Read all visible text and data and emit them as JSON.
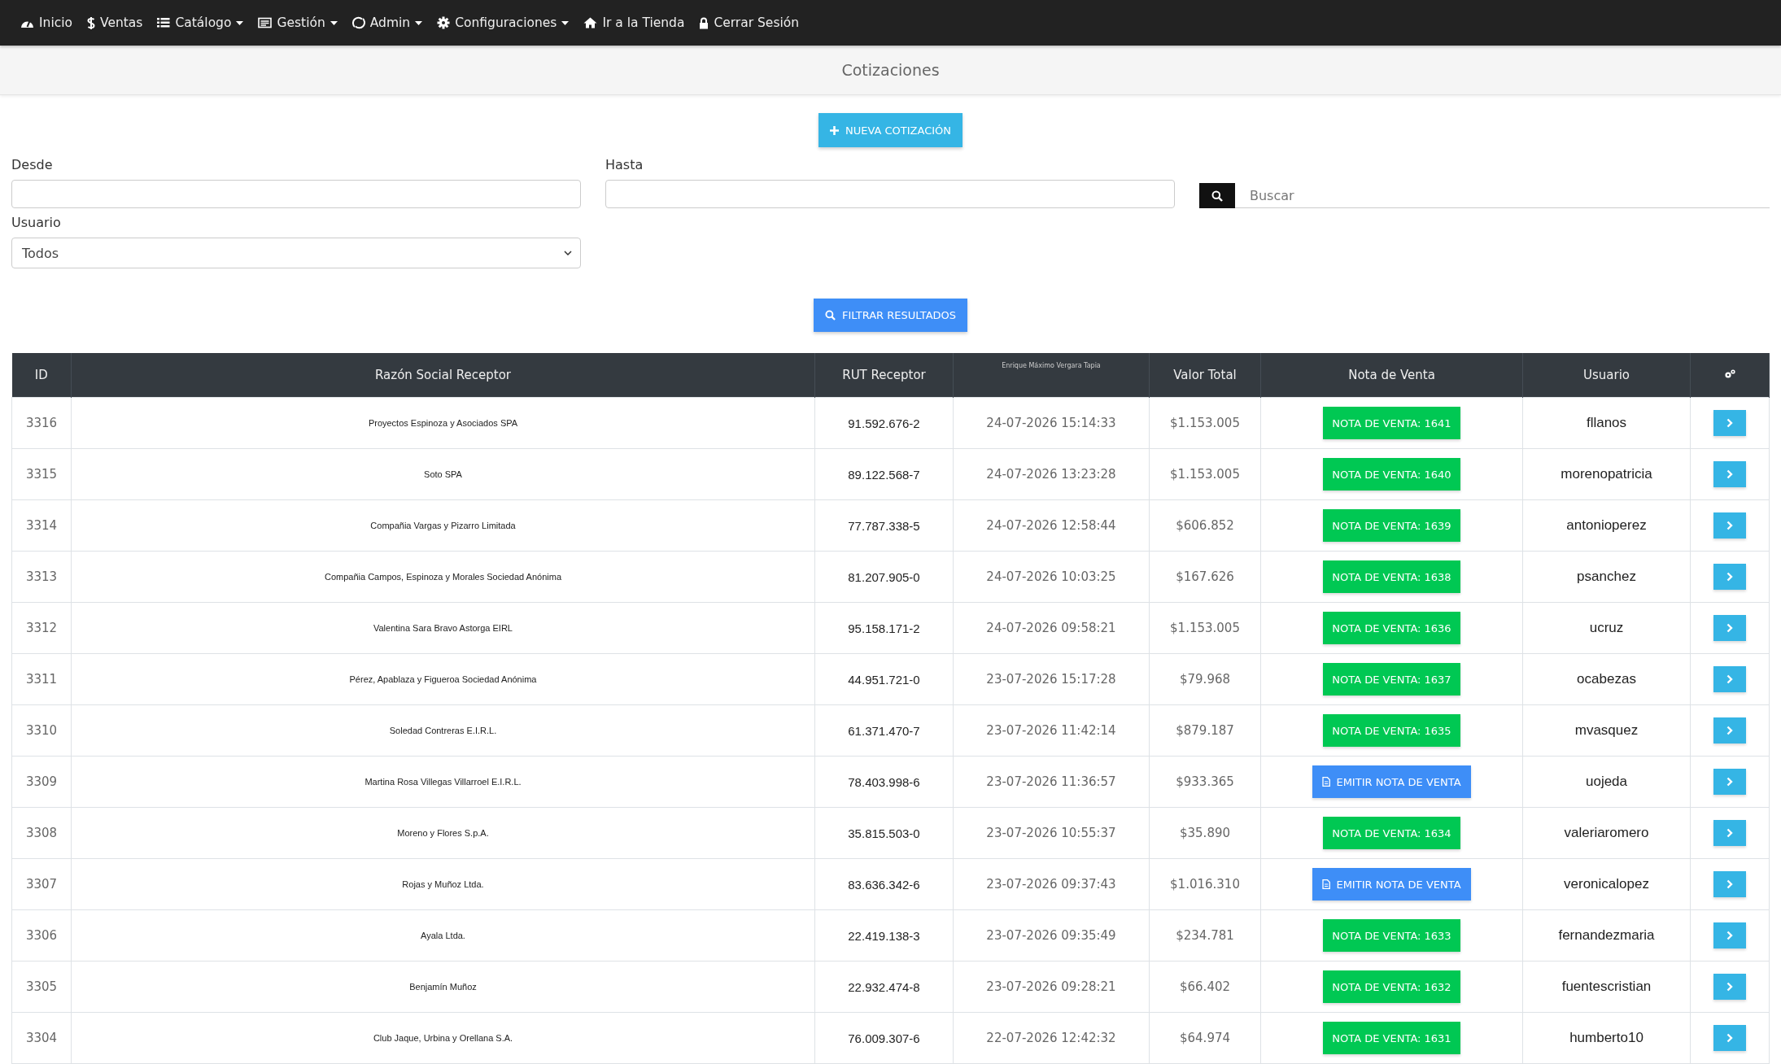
{
  "navbar": {
    "items": [
      {
        "label": "Inicio",
        "dropdown": false
      },
      {
        "label": "Ventas",
        "dropdown": false
      },
      {
        "label": "Catálogo",
        "dropdown": true
      },
      {
        "label": "Gestión",
        "dropdown": true
      },
      {
        "label": "Admin",
        "dropdown": true
      },
      {
        "label": "Configuraciones",
        "dropdown": true
      },
      {
        "label": "Ir a la Tienda",
        "dropdown": false
      },
      {
        "label": "Cerrar Sesión",
        "dropdown": false
      }
    ]
  },
  "page_title": "Cotizaciones",
  "new_button": "NUEVA COTIZACIÓN",
  "filters": {
    "desde": {
      "label": "Desde"
    },
    "hasta": {
      "label": "Hasta"
    },
    "search": {
      "placeholder": "Buscar"
    },
    "usuario": {
      "label": "Usuario",
      "value": "Todos"
    }
  },
  "filter_button": "FILTRAR RESULTADOS",
  "table": {
    "columns": [
      "ID",
      "Razón Social Receptor",
      "RUT Receptor",
      "Enrique Máximo Vergara Tapia",
      "Valor Total",
      "Nota de Venta",
      "Usuario"
    ],
    "rows": [
      {
        "id": "3316",
        "razon": "Proyectos Espinoza y Asociados SPA",
        "rut": "91.592.676-2",
        "fecha": "24-07-2026 15:14:33",
        "valor": "$1.153.005",
        "nota": {
          "kind": "issued",
          "label": "NOTA DE VENTA: 1641"
        },
        "usuario": "fllanos"
      },
      {
        "id": "3315",
        "razon": "Soto SPA",
        "rut": "89.122.568-7",
        "fecha": "24-07-2026 13:23:28",
        "valor": "$1.153.005",
        "nota": {
          "kind": "issued",
          "label": "NOTA DE VENTA: 1640"
        },
        "usuario": "morenopatricia"
      },
      {
        "id": "3314",
        "razon": "Compañia Vargas y Pizarro Limitada",
        "rut": "77.787.338-5",
        "fecha": "24-07-2026 12:58:44",
        "valor": "$606.852",
        "nota": {
          "kind": "issued",
          "label": "NOTA DE VENTA: 1639"
        },
        "usuario": "antonioperez"
      },
      {
        "id": "3313",
        "razon": "Compañia Campos, Espinoza y Morales Sociedad Anónima",
        "rut": "81.207.905-0",
        "fecha": "24-07-2026 10:03:25",
        "valor": "$167.626",
        "nota": {
          "kind": "issued",
          "label": "NOTA DE VENTA: 1638"
        },
        "usuario": "psanchez"
      },
      {
        "id": "3312",
        "razon": "Valentina Sara Bravo Astorga EIRL",
        "rut": "95.158.171-2",
        "fecha": "24-07-2026 09:58:21",
        "valor": "$1.153.005",
        "nota": {
          "kind": "issued",
          "label": "NOTA DE VENTA: 1636"
        },
        "usuario": "ucruz"
      },
      {
        "id": "3311",
        "razon": "Pérez, Apablaza y Figueroa Sociedad Anónima",
        "rut": "44.951.721-0",
        "fecha": "23-07-2026 15:17:28",
        "valor": "$79.968",
        "nota": {
          "kind": "issued",
          "label": "NOTA DE VENTA: 1637"
        },
        "usuario": "ocabezas"
      },
      {
        "id": "3310",
        "razon": "Soledad Contreras E.I.R.L.",
        "rut": "61.371.470-7",
        "fecha": "23-07-2026 11:42:14",
        "valor": "$879.187",
        "nota": {
          "kind": "issued",
          "label": "NOTA DE VENTA: 1635"
        },
        "usuario": "mvasquez"
      },
      {
        "id": "3309",
        "razon": "Martina Rosa Villegas Villarroel E.I.R.L.",
        "rut": "78.403.998-6",
        "fecha": "23-07-2026 11:36:57",
        "valor": "$933.365",
        "nota": {
          "kind": "emit",
          "label": "EMITIR NOTA DE VENTA"
        },
        "usuario": "uojeda"
      },
      {
        "id": "3308",
        "razon": "Moreno y Flores S.p.A.",
        "rut": "35.815.503-0",
        "fecha": "23-07-2026 10:55:37",
        "valor": "$35.890",
        "nota": {
          "kind": "issued",
          "label": "NOTA DE VENTA: 1634"
        },
        "usuario": "valeriaromero"
      },
      {
        "id": "3307",
        "razon": "Rojas y Muñoz Ltda.",
        "rut": "83.636.342-6",
        "fecha": "23-07-2026 09:37:43",
        "valor": "$1.016.310",
        "nota": {
          "kind": "emit",
          "label": "EMITIR NOTA DE VENTA"
        },
        "usuario": "veronicalopez"
      },
      {
        "id": "3306",
        "razon": "Ayala Ltda.",
        "rut": "22.419.138-3",
        "fecha": "23-07-2026 09:35:49",
        "valor": "$234.781",
        "nota": {
          "kind": "issued",
          "label": "NOTA DE VENTA: 1633"
        },
        "usuario": "fernandezmaria"
      },
      {
        "id": "3305",
        "razon": "Benjamín Muñoz",
        "rut": "22.932.474-8",
        "fecha": "23-07-2026 09:28:21",
        "valor": "$66.402",
        "nota": {
          "kind": "issued",
          "label": "NOTA DE VENTA: 1632"
        },
        "usuario": "fuentescristian"
      },
      {
        "id": "3304",
        "razon": "Club Jaque, Urbina y Orellana S.A.",
        "rut": "76.009.307-6",
        "fecha": "22-07-2026 12:42:32",
        "valor": "$64.974",
        "nota": {
          "kind": "issued",
          "label": "NOTA DE VENTA: 1631"
        },
        "usuario": "humberto10"
      }
    ]
  }
}
